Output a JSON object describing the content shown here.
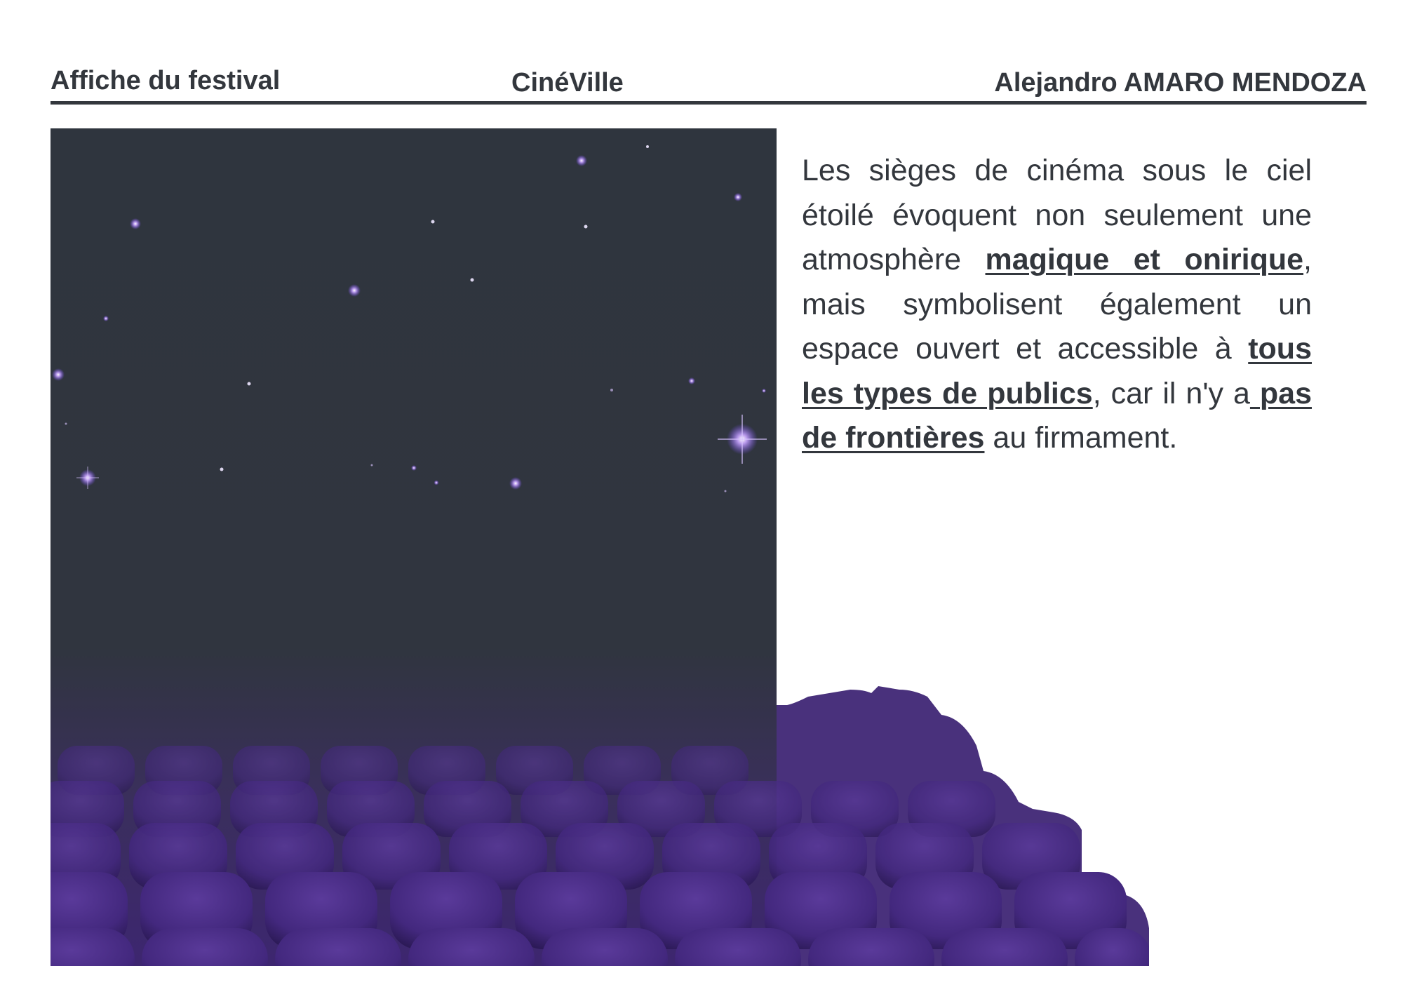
{
  "header": {
    "left": "Affiche du festival",
    "center": "CinéVille",
    "right": "Alejandro AMARO MENDOZA"
  },
  "poster": {
    "image_description_icon": "starry-sky-cinema-seats-illustration",
    "sky_color": "#2f353e",
    "seat_color": "#4a2c86",
    "star_color": "#b38cff"
  },
  "description": {
    "p1": "Les sièges de cinéma sous le ciel étoilé évoquent non seulement une atmosphère ",
    "b1": "magique et onirique",
    "p2": ", mais symbolisent également un espace ouvert et accessible à ",
    "b2": "tous les types de publics",
    "p3": ", car il n'y a",
    "b3": " pas de frontières",
    "p4": " au firmament."
  }
}
